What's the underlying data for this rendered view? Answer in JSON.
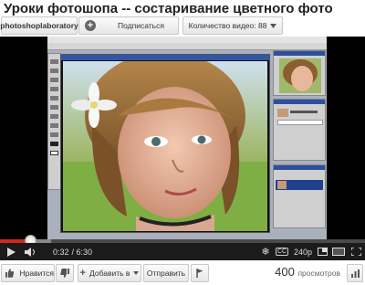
{
  "page": {
    "title": "Уроки фотошопа -- состаривание цветного фото"
  },
  "channel": {
    "name": "photoshoplaboratory",
    "subscribe_label": "Подписаться",
    "video_count_label": "Количество видео: 88"
  },
  "player": {
    "current_time": "0:32",
    "duration": "/ 6:30",
    "progress_fraction": 0.082,
    "buffered_fraction": 0.14,
    "quality_label": "240p"
  },
  "actions": {
    "like_label": "Нравится",
    "add_label": "Добавить в",
    "share_label": "Отправить",
    "views_count": "400",
    "views_label": "просмотров"
  },
  "colors": {
    "progress_played": "#d3261f",
    "player_bg": "#000000"
  }
}
